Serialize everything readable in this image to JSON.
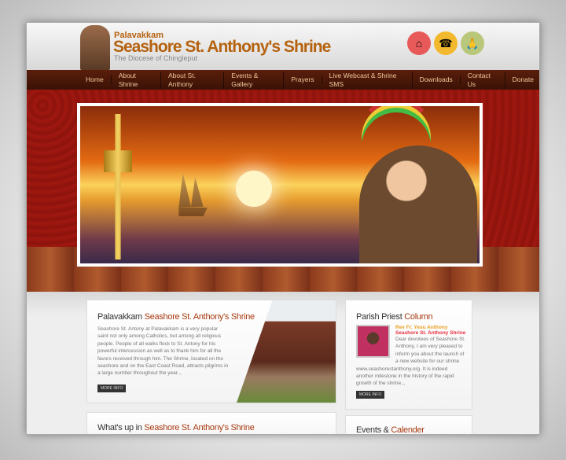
{
  "header": {
    "pre_title": "Palavakkam",
    "title": "Seashore St. Anthony's Shrine",
    "subtitle": "The Diocese of Chingleput",
    "icons": [
      "home-icon",
      "phone-icon",
      "praying-hands-icon"
    ],
    "icon_colors": [
      "#e85a5a",
      "#f2b92e",
      "#b9c77a"
    ]
  },
  "nav": [
    "Home",
    "About Shrine",
    "About St. Anthony",
    "Events & Gallery",
    "Prayers",
    "Live Webcast & Shrine SMS",
    "Downloads",
    "Contact Us",
    "Donate"
  ],
  "about": {
    "title_plain": "Palavakkam",
    "title_accent": "Seashore St. Anthony's Shrine",
    "body": "Seashore St. Antony at Palavakkam is a very popular saint not only among Catholics, but among all religious people. People of all walks flock to St. Antony for his powerful intercession as well as to thank him for all the favors received through him. The Shrine, located on the seashore and on the East Coast Road, attracts pilgrims in a large number throughout the year..,",
    "more": "MORE INFO"
  },
  "whatsup": {
    "title_plain": "What's up in",
    "title_accent": "Seashore St. Anthony's Shrine"
  },
  "priest": {
    "title_plain": "Parish Priest",
    "title_accent": "Column",
    "name": "Rev Fr. Yesu Anthony",
    "org": "Seashore St. Anthony Shrine",
    "body": "Dear devotees of Seashore St. Anthony, I am very pleased to inform you about the launch of a new website for our shrine www.seashorestanthony.org. It is indeed another milestone in the history of the rapid growth of the shrine..,",
    "more": "MORE INFO"
  },
  "events": {
    "title_plain": "Events &",
    "title_accent": "Calender"
  }
}
